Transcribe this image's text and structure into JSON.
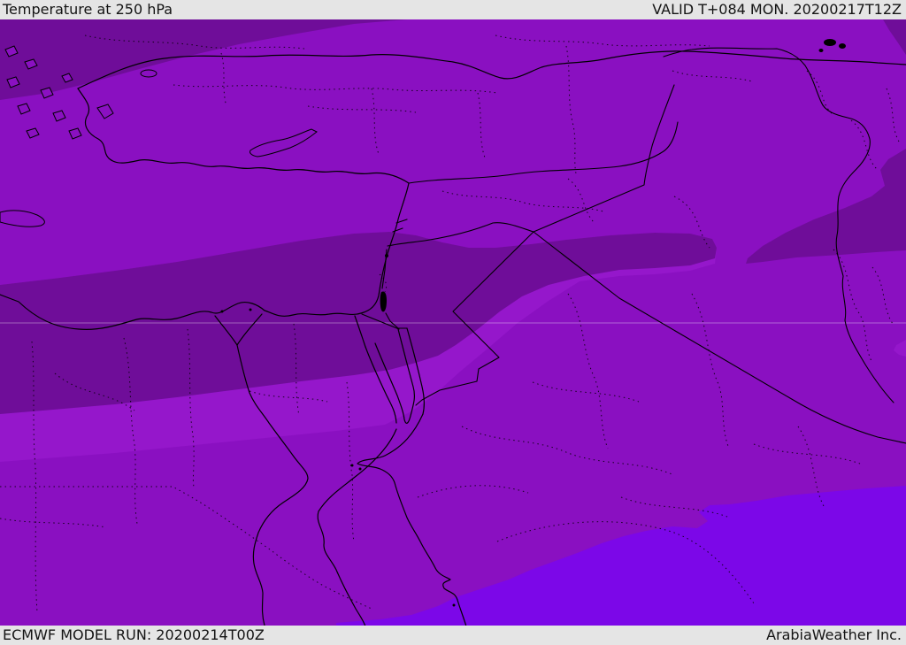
{
  "header": {
    "title": "Temperature at 250 hPa",
    "valid": "VALID T+084 MON. 20200217T12Z"
  },
  "footer": {
    "model_run": "ECMWF MODEL RUN: 20200214T00Z",
    "provider": "ArabiaWeather Inc."
  },
  "map": {
    "parameter": "Temperature",
    "level": "250 hPa",
    "model": "ECMWF",
    "run_time": "20200214T00Z",
    "valid_time": "20200217T12Z",
    "lead_time": "T+084",
    "palette": {
      "base": "#8a10c1",
      "cold_band": "#6f0d99",
      "cool_fringe": "#9517cb",
      "warm_region": "#7c07e8",
      "line": "#000000",
      "graticule": "rgba(255,255,255,0.35)",
      "lake": "#000000",
      "bar_bg": "#e5e5e5",
      "bar_text": "#141414"
    }
  }
}
